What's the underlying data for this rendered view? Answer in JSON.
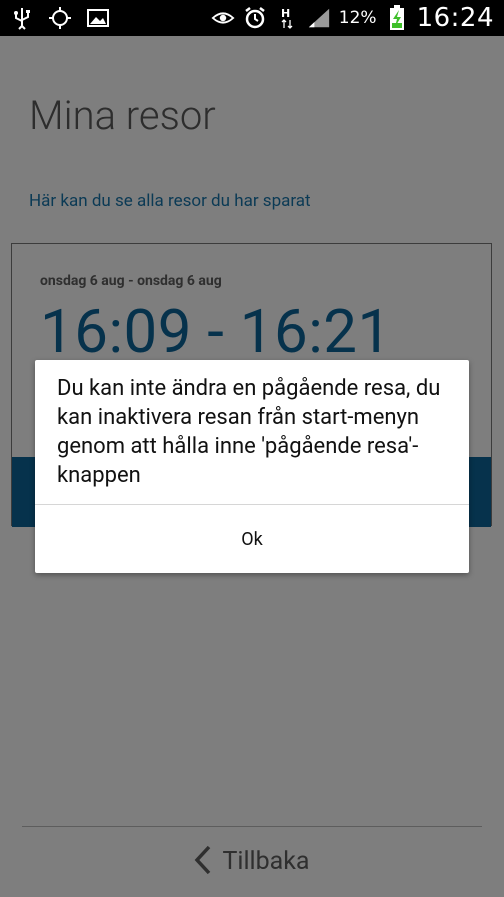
{
  "status_bar": {
    "icons_left": [
      "usb-icon",
      "gps-icon",
      "image-icon"
    ],
    "icons_right": [
      "eye-icon",
      "alarm-icon",
      "network-h-icon",
      "signal-icon",
      "battery-charging-icon"
    ],
    "battery_percent": "12%",
    "time": "16:24"
  },
  "screen": {
    "title": "Mina resor",
    "subtitle": "Här kan du se alla resor du har sparat",
    "trip": {
      "date_range": "onsdag 6 aug - onsdag 6 aug",
      "time_range": "16:09 - 16:21"
    },
    "back_label": "Tillbaka"
  },
  "dialog": {
    "message": "Du kan inte ändra en pågående resa, du kan inaktivera resan från start-menyn genom att hålla inne 'pågående resa'-knappen",
    "ok_label": "Ok"
  },
  "colors": {
    "accent": "#06324c",
    "overlay_bg": "#7e7e7e",
    "status_bar": "#000000"
  }
}
